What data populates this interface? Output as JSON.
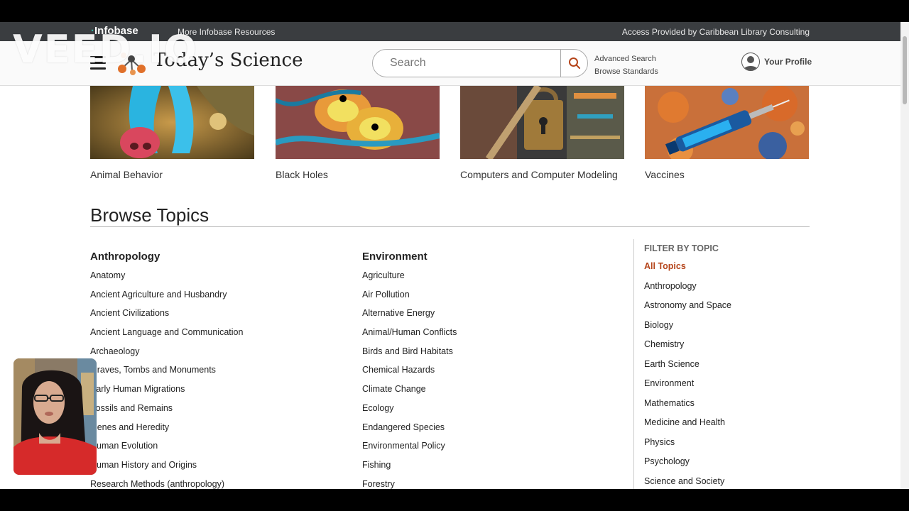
{
  "topbar": {
    "brand": "Infobase",
    "more_resources": "More Infobase Resources",
    "access": "Access Provided by Caribbean Library Consulting"
  },
  "header": {
    "site_title": "Today’s Science",
    "search_placeholder": "Search",
    "advanced_search": "Advanced Search",
    "browse_standards": "Browse Standards",
    "profile_label": "Your Profile"
  },
  "featured": [
    {
      "caption": "Animal Behavior"
    },
    {
      "caption": "Black Holes"
    },
    {
      "caption": "Computers and Computer Modeling"
    },
    {
      "caption": "Vaccines"
    }
  ],
  "browse": {
    "title": "Browse Topics",
    "columns": [
      {
        "heading": "Anthropology",
        "items": [
          "Anatomy",
          "Ancient Agriculture and Husbandry",
          "Ancient Civilizations",
          "Ancient Language and Communication",
          "Archaeology",
          "Graves, Tombs and Monuments",
          "Early Human Migrations",
          "Fossils and Remains",
          "Genes and Heredity",
          "Human Evolution",
          "Human History and Origins",
          "Research Methods (anthropology)"
        ]
      },
      {
        "heading": "Environment",
        "items": [
          "Agriculture",
          "Air Pollution",
          "Alternative Energy",
          "Animal/Human Conflicts",
          "Birds and Bird Habitats",
          "Chemical Hazards",
          "Climate Change",
          "Ecology",
          "Endangered Species",
          "Environmental Policy",
          "Fishing",
          "Forestry"
        ]
      }
    ]
  },
  "filter": {
    "heading": "FILTER BY TOPIC",
    "items": [
      "All Topics",
      "Anthropology",
      "Astronomy and Space",
      "Biology",
      "Chemistry",
      "Earth Science",
      "Environment",
      "Mathematics",
      "Medicine and Health",
      "Physics",
      "Psychology",
      "Science and Society"
    ],
    "active_color": "#b5451b"
  },
  "overlay": {
    "watermark": "VEED.IO"
  }
}
